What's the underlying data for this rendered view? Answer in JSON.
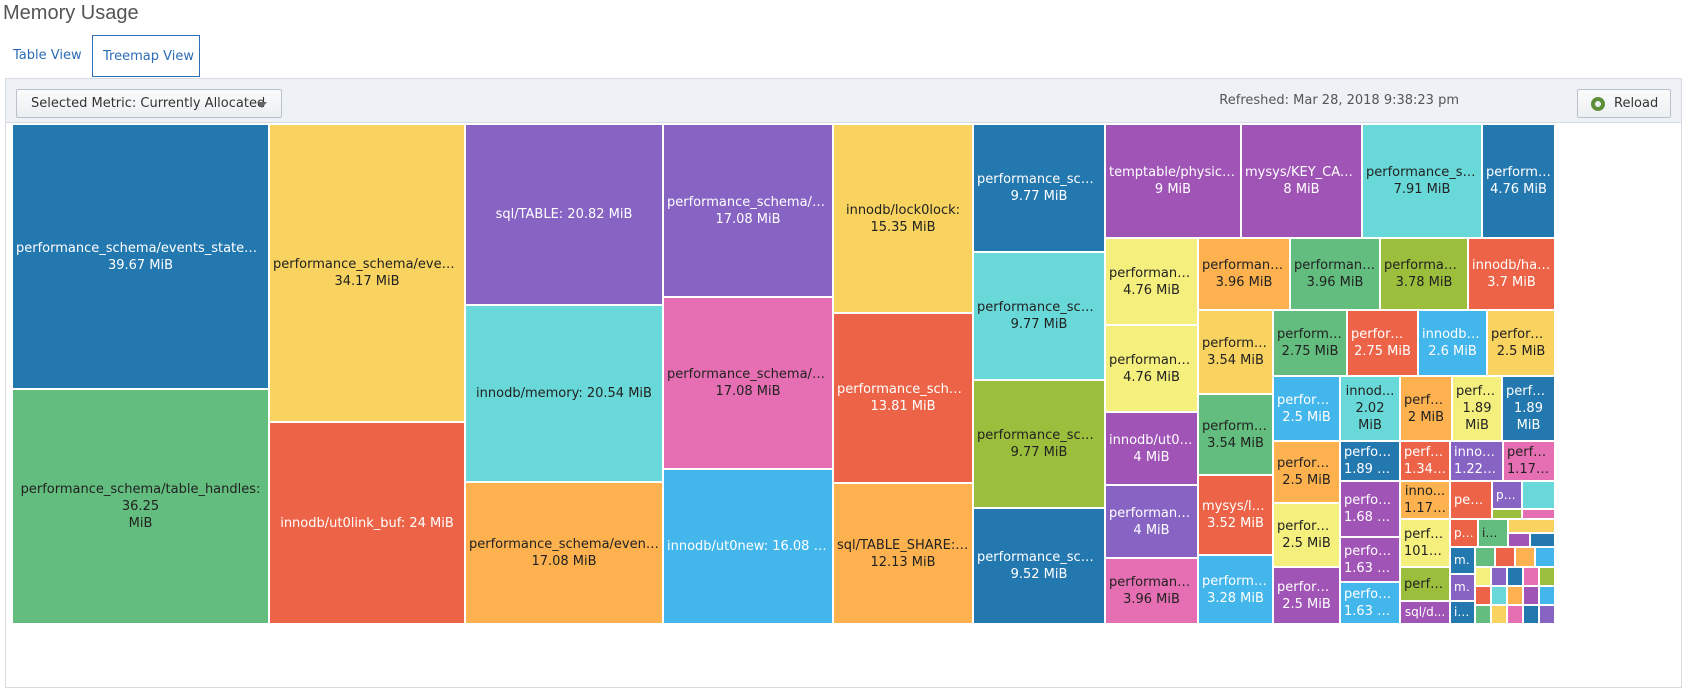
{
  "page": {
    "title": "Memory Usage"
  },
  "tabs": [
    {
      "label": "Table View"
    },
    {
      "label": "Treemap View"
    }
  ],
  "toolbar": {
    "metric_label": "Selected Metric: Currently Allocated",
    "refreshed": "Refreshed: Mar 28, 2018 9:38:23 pm",
    "reload_label": "Reload"
  },
  "colors": {
    "dark_blue": "#2378b0",
    "green": "#63bd7e",
    "yellow": "#f8d35f",
    "red": "#ec6347",
    "purple": "#8763c4",
    "cyan": "#69d8d8",
    "orange": "#fdb24f",
    "pink": "#e56fb2",
    "sky": "#43b6ec",
    "olive": "#9bbe3c",
    "magenta": "#a054b6",
    "light_yellow": "#f5f07e"
  },
  "treemap": {
    "cells": [
      {
        "name": "performance_schema/events_statements_s...",
        "value": "39.67 MiB",
        "color": "#2378b0"
      },
      {
        "name": "performance_schema/table_handles: 36.25",
        "value": "MiB",
        "color": "#63bd7e"
      },
      {
        "name": "performance_schema/events_er...",
        "value": "34.17 MiB",
        "color": "#f8d35f"
      },
      {
        "name": "innodb/ut0link_buf: 24 MiB",
        "value": "",
        "color": "#ec6347"
      },
      {
        "name": "sql/TABLE: 20.82 MiB",
        "value": "",
        "color": "#8763c4"
      },
      {
        "name": "innodb/memory: 20.54 MiB",
        "value": "",
        "color": "#69d8d8"
      },
      {
        "name": "performance_schema/events_err...",
        "value": "17.08 MiB",
        "color": "#fdb24f"
      },
      {
        "name": "performance_schema/even...",
        "value": "17.08 MiB",
        "color": "#8763c4"
      },
      {
        "name": "performance_schema/even...",
        "value": "17.08 MiB",
        "color": "#e56fb2"
      },
      {
        "name": "innodb/ut0new: 16.08 MiB",
        "value": "",
        "color": "#43b6ec"
      },
      {
        "name": "innodb/lock0lock:",
        "value": "15.35 MiB",
        "color": "#f8d35f"
      },
      {
        "name": "performance_schema...",
        "value": "13.81 MiB",
        "color": "#ec6347"
      },
      {
        "name": "sql/TABLE_SHARE::me...",
        "value": "12.13 MiB",
        "color": "#fdb24f"
      },
      {
        "name": "performance_schem...",
        "value": "9.77 MiB",
        "color": "#2378b0"
      },
      {
        "name": "performance_schem...",
        "value": "9.77 MiB",
        "color": "#69d8d8"
      },
      {
        "name": "performance_schem...",
        "value": "9.77 MiB",
        "color": "#9bbe3c"
      },
      {
        "name": "performance_schem...",
        "value": "9.52 MiB",
        "color": "#2378b0"
      },
      {
        "name": "temptable/physical_r...",
        "value": "9 MiB",
        "color": "#a054b6"
      },
      {
        "name": "mysys/KEY_CACHE:",
        "value": "8 MiB",
        "color": "#a054b6"
      },
      {
        "name": "performance_sche...",
        "value": "7.91 MiB",
        "color": "#69d8d8"
      },
      {
        "name": "performa...",
        "value": "4.76 MiB",
        "color": "#2378b0"
      },
      {
        "name": "performance_...",
        "value": "4.76 MiB",
        "color": "#f5f07e"
      },
      {
        "name": "performance_...",
        "value": "4.76 MiB",
        "color": "#f5f07e"
      },
      {
        "name": "innodb/ut0p...",
        "value": "4 MiB",
        "color": "#a054b6"
      },
      {
        "name": "performance_...",
        "value": "4 MiB",
        "color": "#8763c4"
      },
      {
        "name": "performance_...",
        "value": "3.96 MiB",
        "color": "#e56fb2"
      },
      {
        "name": "performance...",
        "value": "3.96 MiB",
        "color": "#fdb24f"
      },
      {
        "name": "performance...",
        "value": "3.96 MiB",
        "color": "#63bd7e"
      },
      {
        "name": "performanc...",
        "value": "3.78 MiB",
        "color": "#9bbe3c"
      },
      {
        "name": "innodb/has...",
        "value": "3.7 MiB",
        "color": "#ec6347"
      },
      {
        "name": "performa...",
        "value": "3.54 MiB",
        "color": "#f8d35f"
      },
      {
        "name": "performa...",
        "value": "3.54 MiB",
        "color": "#63bd7e"
      },
      {
        "name": "mysys/lf_...",
        "value": "3.52 MiB",
        "color": "#ec6347"
      },
      {
        "name": "performa...",
        "value": "3.28 MiB",
        "color": "#43b6ec"
      },
      {
        "name": "performa...",
        "value": "2.75 MiB",
        "color": "#63bd7e"
      },
      {
        "name": "performa...",
        "value": "2.75 MiB",
        "color": "#ec6347"
      },
      {
        "name": "innodb/o...",
        "value": "2.6 MiB",
        "color": "#43b6ec"
      },
      {
        "name": "perform...",
        "value": "2.5 MiB",
        "color": "#f8d35f"
      },
      {
        "name": "performa...",
        "value": "2.5 MiB",
        "color": "#43b6ec"
      },
      {
        "name": "innod...",
        "value": "2.02",
        "value2": "MiB",
        "color": "#69d8d8"
      },
      {
        "name": "perfor...",
        "value": "2 MiB",
        "color": "#fdb24f"
      },
      {
        "name": "perfo...",
        "value": "1.89",
        "value2": "MiB",
        "color": "#f5f07e"
      },
      {
        "name": "perfor...",
        "value": "1.89",
        "value2": "MiB",
        "color": "#2378b0"
      },
      {
        "name": "performa...",
        "value": "2.5 MiB",
        "color": "#fdb24f"
      },
      {
        "name": "performa...",
        "value": "2.5 MiB",
        "color": "#f5f07e"
      },
      {
        "name": "performa...",
        "value": "2.5 MiB",
        "color": "#a054b6"
      },
      {
        "name": "perform...",
        "value": "1.89 MiB",
        "color": "#2378b0"
      },
      {
        "name": "perform...",
        "value": "1.68 MiB",
        "color": "#a054b6"
      },
      {
        "name": "perform...",
        "value": "1.63 MiB",
        "color": "#a054b6"
      },
      {
        "name": "perform...",
        "value": "1.63 MiB",
        "color": "#43b6ec"
      },
      {
        "name": "perfo...",
        "value": "1.34 M...",
        "color": "#ec6347"
      },
      {
        "name": "innod...",
        "value": "1.22 ...",
        "color": "#8763c4"
      },
      {
        "name": "perfo...",
        "value": "1.17 ...",
        "color": "#e56fb2"
      },
      {
        "name": "inno...",
        "value": "1.17 ...",
        "color": "#fdb24f"
      },
      {
        "name": "perfo...",
        "value": "1015....",
        "color": "#f5f07e"
      },
      {
        "name": "perfo...",
        "value": "",
        "color": "#9bbe3c"
      },
      {
        "name": "sql/d...",
        "value": "",
        "color": "#a054b6"
      },
      {
        "name": "perf...",
        "value": "",
        "color": "#ec6347"
      },
      {
        "name": "pe...",
        "value": "",
        "color": "#8763c4"
      },
      {
        "name": "pe...",
        "value": "",
        "color": "#ec6347"
      },
      {
        "name": "in...",
        "value": "",
        "color": "#63bd7e"
      },
      {
        "name": "m...",
        "value": "",
        "color": "#2378b0"
      },
      {
        "name": "m...",
        "value": "",
        "color": "#8763c4"
      },
      {
        "name": "in...",
        "value": "",
        "color": "#2378b0"
      }
    ]
  }
}
